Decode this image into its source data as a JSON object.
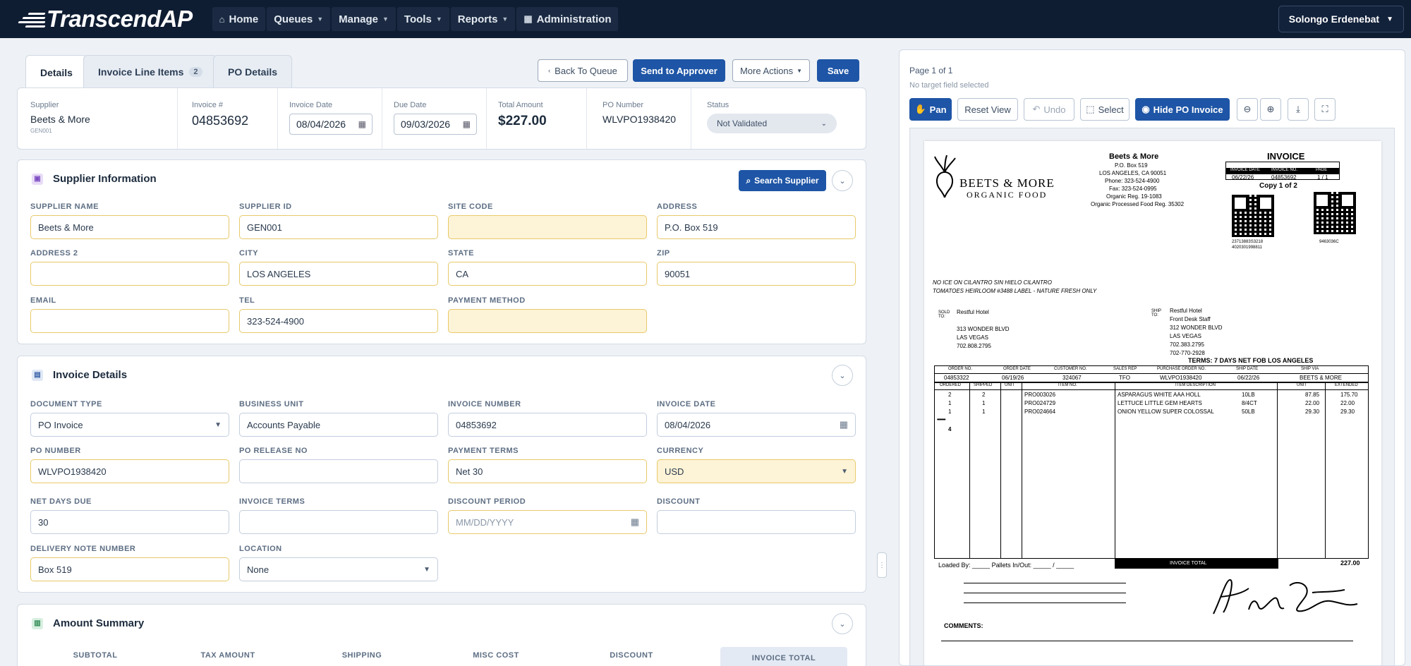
{
  "nav": {
    "brand": "TranscendAP",
    "items": [
      {
        "label": "Home",
        "icon": "home-icon",
        "caret": false
      },
      {
        "label": "Queues",
        "icon": "",
        "caret": true
      },
      {
        "label": "Manage",
        "icon": "",
        "caret": true
      },
      {
        "label": "Tools",
        "icon": "",
        "caret": true
      },
      {
        "label": "Reports",
        "icon": "",
        "caret": true
      },
      {
        "label": "Administration",
        "icon": "grid-icon",
        "caret": false
      }
    ],
    "user": "Solongo Erdenebat"
  },
  "tabs": {
    "details": "Details",
    "line_items": "Invoice Line Items",
    "line_items_count": "2",
    "po_details": "PO Details"
  },
  "actions": {
    "back": "Back To Queue",
    "send": "Send to Approver",
    "more": "More Actions",
    "save": "Save"
  },
  "summary": {
    "supplier_label": "Supplier",
    "supplier": "Beets & More",
    "supplier_code": "GEN001",
    "invoice_no_label": "Invoice #",
    "invoice_no": "04853692",
    "invoice_date_label": "Invoice Date",
    "invoice_date": "08/04/2026",
    "due_date_label": "Due Date",
    "due_date": "09/03/2026",
    "total_label": "Total Amount",
    "total": "$227.00",
    "po_label": "PO Number",
    "po": "WLVPO1938420",
    "status_label": "Status",
    "status": "Not Validated"
  },
  "supplier_section": {
    "title": "Supplier Information",
    "search_btn": "Search Supplier",
    "fields": {
      "supplier_name": {
        "label": "SUPPLIER NAME",
        "value": "Beets & More"
      },
      "supplier_id": {
        "label": "SUPPLIER ID",
        "value": "GEN001"
      },
      "site_code": {
        "label": "SITE CODE",
        "value": ""
      },
      "address": {
        "label": "ADDRESS",
        "value": "P.O. Box 519"
      },
      "address2": {
        "label": "ADDRESS 2",
        "value": ""
      },
      "city": {
        "label": "CITY",
        "value": "LOS ANGELES"
      },
      "state": {
        "label": "STATE",
        "value": "CA"
      },
      "zip": {
        "label": "ZIP",
        "value": "90051"
      },
      "email": {
        "label": "EMAIL",
        "value": ""
      },
      "tel": {
        "label": "TEL",
        "value": "323-524-4900"
      },
      "payment_method": {
        "label": "PAYMENT METHOD",
        "value": ""
      }
    }
  },
  "invoice_section": {
    "title": "Invoice Details",
    "fields": {
      "document_type": {
        "label": "DOCUMENT TYPE",
        "value": "PO Invoice"
      },
      "business_unit": {
        "label": "BUSINESS UNIT",
        "value": "Accounts Payable"
      },
      "invoice_number": {
        "label": "INVOICE NUMBER",
        "value": "04853692"
      },
      "invoice_date": {
        "label": "INVOICE DATE",
        "value": "08/04/2026"
      },
      "po_number": {
        "label": "PO NUMBER",
        "value": "WLVPO1938420"
      },
      "po_release": {
        "label": "PO RELEASE NO",
        "value": ""
      },
      "payment_terms": {
        "label": "PAYMENT TERMS",
        "value": "Net 30"
      },
      "currency": {
        "label": "CURRENCY",
        "value": "USD"
      },
      "net_days": {
        "label": "NET DAYS DUE",
        "value": "30"
      },
      "invoice_terms": {
        "label": "INVOICE TERMS",
        "value": ""
      },
      "discount_period": {
        "label": "DISCOUNT PERIOD",
        "placeholder": "MM/DD/YYYY"
      },
      "discount": {
        "label": "DISCOUNT",
        "value": ""
      },
      "delivery_note": {
        "label": "DELIVERY NOTE NUMBER",
        "value": "Box 519"
      },
      "location": {
        "label": "LOCATION",
        "value": "None"
      }
    }
  },
  "amount_section": {
    "title": "Amount Summary",
    "columns": [
      "SUBTOTAL",
      "TAX AMOUNT",
      "SHIPPING",
      "MISC COST",
      "DISCOUNT",
      "INVOICE TOTAL"
    ]
  },
  "viewer": {
    "page": "Page 1 of 1",
    "target": "No target field selected",
    "tools": {
      "pan": "Pan",
      "reset": "Reset View",
      "undo": "Undo",
      "select": "Select",
      "hide": "Hide PO Invoice"
    }
  },
  "doc": {
    "company": "BEETS & MORE",
    "company_sub": "ORGANIC FOOD",
    "hdr_name": "Beets & More",
    "hdr_lines": [
      "P.O. Box 519",
      "LOS ANGELES, CA 90051",
      "Phone: 323-524-4900",
      "Fax: 323-524-0995",
      "Organic Reg. 19-1083",
      "Organic Processed Food Reg. 35302"
    ],
    "invoice_word": "INVOICE",
    "box_heads": [
      "INVOICE DATE",
      "INVOICE NO.",
      "PAGE"
    ],
    "box_vals": [
      "06/22/26",
      "04853692",
      "1 / 1"
    ],
    "copy": "Copy 1 of 2",
    "qr_left_caption_1": "23713883S3218",
    "qr_left_caption_2": "4020301998811",
    "qr_right_caption": "9463036C",
    "note1": "NO ICE ON CILANTRO SIN HIELO CILANTRO",
    "note2": "TOMATOES HEIRLOOM #3488 LABEL - NATURE FRESH ONLY",
    "sold_lbl": "SOLD TO:",
    "sold": [
      "Restful Hotel",
      "313 WONDER BLVD",
      "LAS VEGAS",
      "702.808.2795"
    ],
    "ship_lbl": "SHIP TO:",
    "ship": [
      "Restful Hotel",
      "Front Desk Staff",
      "312 WONDER BLVD",
      "LAS VEGAS",
      "702.383.2795",
      "702-770-2928"
    ],
    "terms": "TERMS: 7 DAYS NET FOB LOS ANGELES",
    "o_heads": [
      "ORDER NO.",
      "ORDER DATE",
      "CUSTOMER NO.",
      "SALES REP",
      "PURCHASE ORDER NO.",
      "SHIP DATE",
      "SHIP VIA"
    ],
    "o_vals": [
      "04853322",
      "06/19/26",
      "324067",
      "TFO",
      "WLVPO1938420",
      "06/22/26",
      "BEETS & MORE"
    ],
    "l_heads": [
      "ORDERED",
      "SHIPPED",
      "UNIT",
      "ITEM NO.",
      "ITEM DESCRIPTION",
      "UNIT",
      "EXTENDED"
    ],
    "lines": [
      [
        "2",
        "2",
        "PRO003026",
        "ASPARAGUS WHITE AAA HOLL",
        "10LB",
        "87.85",
        "175.70"
      ],
      [
        "1",
        "1",
        "PRO024729",
        "LETTUCE LITTLE GEM HEARTS",
        "8/4CT",
        "22.00",
        "22.00"
      ],
      [
        "1",
        "1",
        "PRO024664",
        "ONION YELLOW SUPER COLOSSAL",
        "50LB",
        "29.30",
        "29.30"
      ]
    ],
    "tally_marks": "••••••••",
    "tally": "4",
    "loaded_by": "Loaded By: _____  Pallets In/Out: _____ / _____",
    "invoice_total_lbl": "INVOICE TOTAL",
    "invoice_total": "227.00",
    "comments": "COMMENTS:"
  }
}
